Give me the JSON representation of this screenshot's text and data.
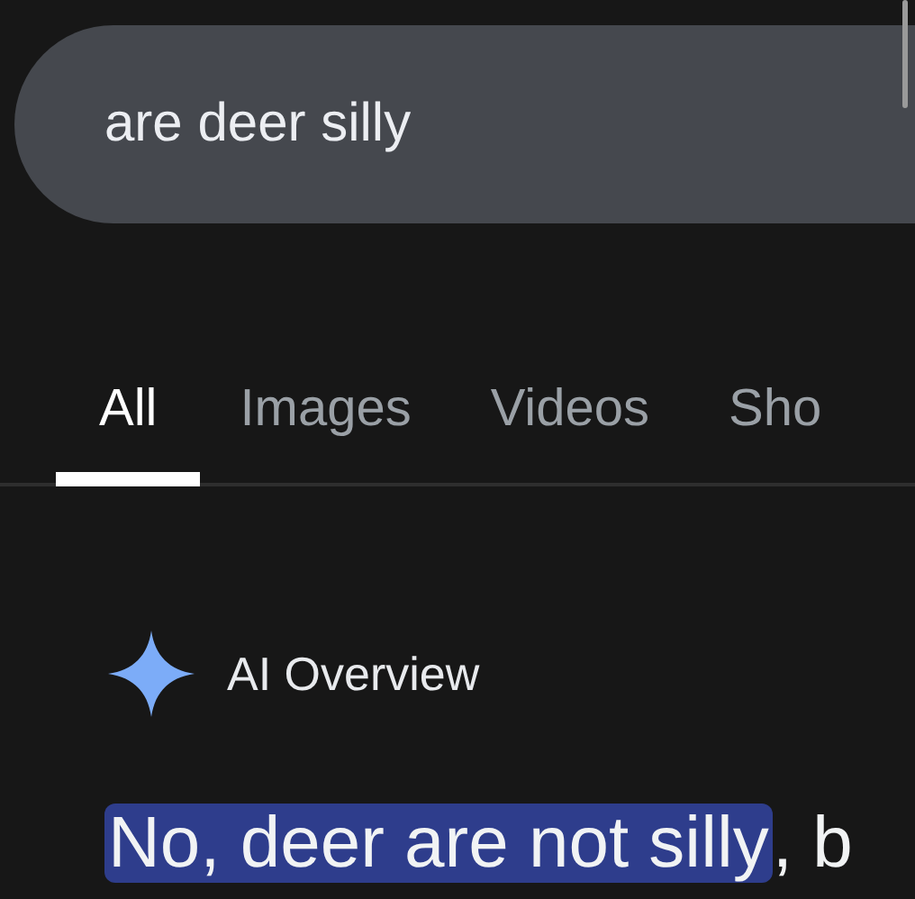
{
  "search": {
    "value": "are deer silly"
  },
  "tabs": [
    {
      "label": "All",
      "selected": true
    },
    {
      "label": "Images",
      "selected": false
    },
    {
      "label": "Videos",
      "selected": false
    },
    {
      "label": "Sho",
      "selected": false
    }
  ],
  "ai_overview": {
    "title": "AI Overview",
    "answer": {
      "highlighted": "No, deer are not silly",
      "rest": ", b"
    }
  }
}
